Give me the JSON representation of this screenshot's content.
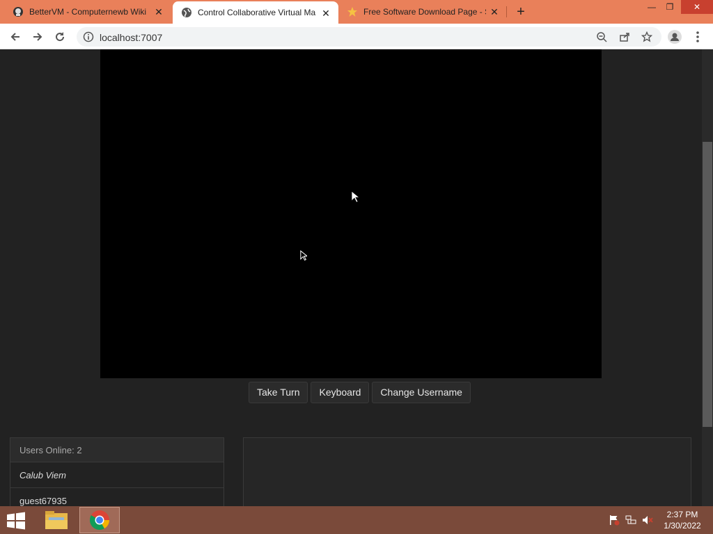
{
  "browser": {
    "tabs": [
      {
        "title": "BetterVM - Computernewb Wiki",
        "favicon": "wiki-icon",
        "active": false
      },
      {
        "title": "Control Collaborative Virtual Ma",
        "favicon": "globe-icon",
        "active": true
      },
      {
        "title": "Free Software Download Page - S",
        "favicon": "star-icon",
        "active": false
      }
    ],
    "url": "localhost:7007"
  },
  "vm": {
    "buttons": {
      "take_turn": "Take Turn",
      "keyboard": "Keyboard",
      "change_username": "Change Username"
    }
  },
  "users": {
    "header": "Users Online: 2",
    "list": [
      "Calub Viem",
      "guest67935"
    ]
  },
  "taskbar": {
    "time": "2:37 PM",
    "date": "1/30/2022"
  },
  "colors": {
    "tabbar": "#e9805a",
    "page_bg": "#222222",
    "taskbar": "#7a4a3a"
  }
}
